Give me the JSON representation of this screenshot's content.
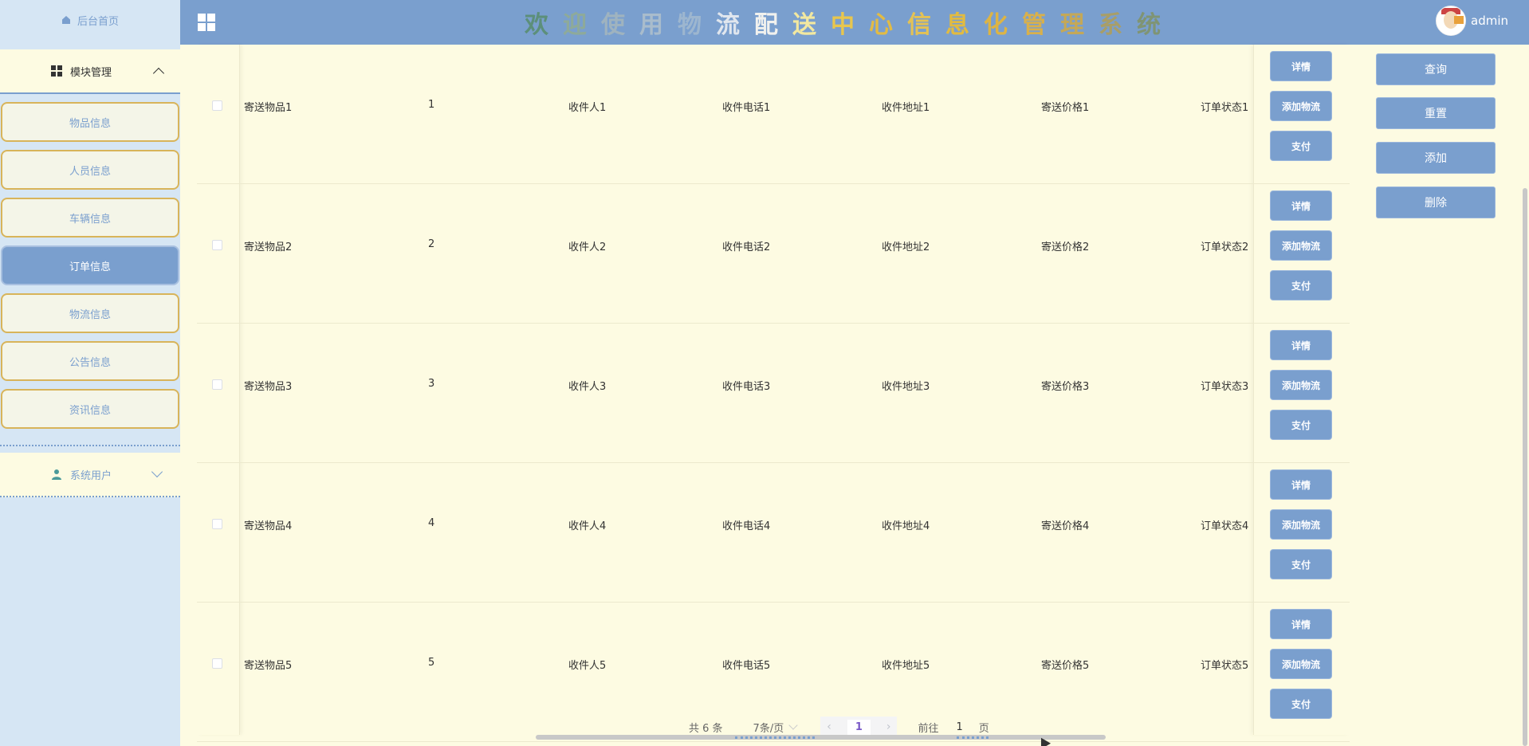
{
  "sidebar": {
    "home_label": "后台首页",
    "module_label": "模块管理",
    "menu_items": [
      {
        "label": "物品信息",
        "active": false
      },
      {
        "label": "人员信息",
        "active": false
      },
      {
        "label": "车辆信息",
        "active": false
      },
      {
        "label": "订单信息",
        "active": true
      },
      {
        "label": "物流信息",
        "active": false
      },
      {
        "label": "公告信息",
        "active": false
      },
      {
        "label": "资讯信息",
        "active": false
      }
    ],
    "users_label": "系统用户"
  },
  "header": {
    "title_chars": [
      "欢",
      "迎",
      "使",
      "用",
      "物",
      "流",
      "配",
      "送",
      "中",
      "心",
      "信",
      "息",
      "化",
      "管",
      "理",
      "系",
      "统"
    ],
    "title_colors": [
      "#5c8f7a",
      "#8eaa9a",
      "#9fb3bf",
      "#a9bccc",
      "#9db6cf",
      "#e0e6ee",
      "#f1f1ee",
      "#f2e8a0",
      "#e8c64e",
      "#e2bb44",
      "#e4c254",
      "#e2bb40",
      "#ddb444",
      "#d8b04c",
      "#c4a858",
      "#a89e68",
      "#7f9474"
    ],
    "username": "admin"
  },
  "table": {
    "rows": [
      {
        "item": "寄送物品1",
        "qty": "1",
        "receiver": "收件人1",
        "phone": "收件电话1",
        "address": "收件地址1",
        "price": "寄送价格1",
        "status": "订单状态1"
      },
      {
        "item": "寄送物品2",
        "qty": "2",
        "receiver": "收件人2",
        "phone": "收件电话2",
        "address": "收件地址2",
        "price": "寄送价格2",
        "status": "订单状态2"
      },
      {
        "item": "寄送物品3",
        "qty": "3",
        "receiver": "收件人3",
        "phone": "收件电话3",
        "address": "收件地址3",
        "price": "寄送价格3",
        "status": "订单状态3"
      },
      {
        "item": "寄送物品4",
        "qty": "4",
        "receiver": "收件人4",
        "phone": "收件电话4",
        "address": "收件地址4",
        "price": "寄送价格4",
        "status": "订单状态4"
      },
      {
        "item": "寄送物品5",
        "qty": "5",
        "receiver": "收件人5",
        "phone": "收件电话5",
        "address": "收件地址5",
        "price": "寄送价格5",
        "status": "订单状态5"
      }
    ],
    "row_buttons": {
      "detail": "详情",
      "add_logistics": "添加物流",
      "pay": "支付"
    }
  },
  "actions": {
    "query": "查询",
    "reset": "重置",
    "add": "添加",
    "delete": "删除"
  },
  "pagination": {
    "total": "共 6 条",
    "page_size": "7条/页",
    "current_page": "1",
    "goto_label": "前往",
    "goto_value": "1",
    "page_suffix": "页"
  },
  "colors": {
    "primary": "#7a9fce",
    "sidebar_bg": "#d6e6f4",
    "content_bg": "#fdfbe2",
    "menu_border": "#d8b45a"
  }
}
